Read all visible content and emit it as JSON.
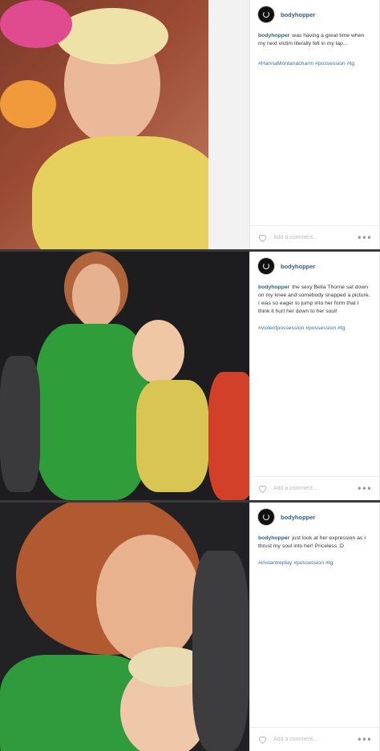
{
  "posts": [
    {
      "username": "bodyhopper",
      "caption": "was having a great time when my next victim literally fell in my lap...",
      "tags": "#HannaMontanacharm #possession #tg",
      "comment_placeholder": "Add a comment...",
      "more_glyph": "•••"
    },
    {
      "username": "bodyhopper",
      "caption": "the sexy Bella Thorne sat down on my knee and somebody snapped a picture. I was so eager to jump into her form that I think it hurt her down to her soul!",
      "tags": "#violentpossession #possession #tg",
      "comment_placeholder": "Add a comment...",
      "more_glyph": "•••"
    },
    {
      "username": "bodyhopper",
      "caption": "just look at her expression as I thrust my soul into her! Priceless :D",
      "tags": "#instantreplay #possession #tg",
      "comment_placeholder": "Add a comment...",
      "more_glyph": "•••"
    }
  ],
  "colors": {
    "username": "#2c5e8e",
    "tag_link": "#3c6ea6",
    "divider": "#3a3a3a"
  },
  "icons": {
    "avatar": "avatar-icon",
    "like": "heart-icon",
    "more": "more-options-icon"
  }
}
